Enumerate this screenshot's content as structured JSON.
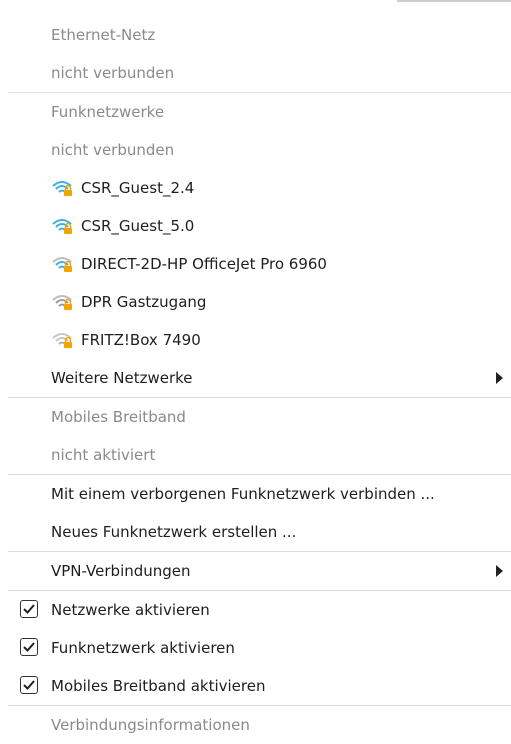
{
  "sections": {
    "ethernet": {
      "title": "Ethernet-Netz",
      "status": "nicht verbunden"
    },
    "wifi": {
      "title": "Funknetzwerke",
      "status": "nicht verbunden",
      "networks": [
        {
          "name": "CSR_Guest_2.4",
          "icon": "wifi-lock-icon",
          "color": "#3daee9"
        },
        {
          "name": "CSR_Guest_5.0",
          "icon": "wifi-lock-icon",
          "color": "#3daee9"
        },
        {
          "name": "DIRECT-2D-HP OfficeJet Pro 6960",
          "icon": "wifi-lock-icon",
          "color": "#3daee9"
        },
        {
          "name": "DPR Gastzugang",
          "icon": "wifi-lock-icon",
          "color": "#9a9a9a"
        },
        {
          "name": "FRITZ!Box 7490",
          "icon": "wifi-lock-icon",
          "color": "#b0b0b0"
        }
      ],
      "more_label": "Weitere Netzwerke"
    },
    "mobile": {
      "title": "Mobiles Breitband",
      "status": "nicht aktiviert"
    },
    "actions": {
      "hidden_network": "Mit einem verborgenen Funknetzwerk verbinden ...",
      "new_network": "Neues Funknetzwerk erstellen ..."
    },
    "vpn": {
      "label": "VPN-Verbindungen"
    },
    "toggles": [
      {
        "label": "Netzwerke aktivieren",
        "checked": true
      },
      {
        "label": "Funknetzwerk aktivieren",
        "checked": true
      },
      {
        "label": "Mobiles Breitband aktivieren",
        "checked": true
      }
    ],
    "info": {
      "label": "Verbindungsinformationen"
    }
  },
  "colors": {
    "lock": "#f0a500",
    "separator": "#dddddd"
  }
}
